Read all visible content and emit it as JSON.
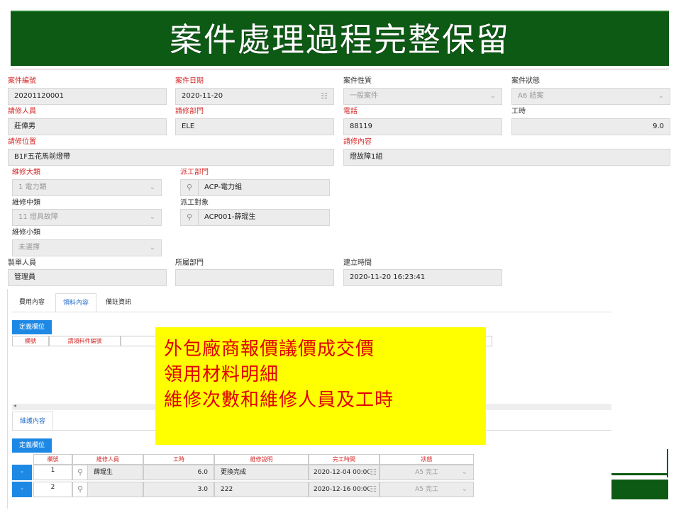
{
  "title": "案件處理過程完整保留",
  "form": {
    "case_no": {
      "label": "案件編號",
      "value": "20201120001"
    },
    "case_date": {
      "label": "案件日期",
      "value": "2020-11-20"
    },
    "case_type": {
      "label": "案件性質",
      "value": "一般案件"
    },
    "case_status": {
      "label": "案件狀態",
      "value": "A6 結案"
    },
    "requester": {
      "label": "請修人員",
      "value": "莊偉男"
    },
    "req_dept": {
      "label": "請修部門",
      "value": "ELE"
    },
    "phone": {
      "label": "電話",
      "value": "88119"
    },
    "work_hours": {
      "label": "工時",
      "value": "9.0"
    },
    "location": {
      "label": "請修位置",
      "value": "B1F五花馬前燈帶"
    },
    "content": {
      "label": "請修內容",
      "value": "燈故障1組"
    },
    "cat_major": {
      "label": "維修大類",
      "value": "1 電力類"
    },
    "dispatch_dept": {
      "label": "派工部門",
      "value": "ACP-電力組"
    },
    "cat_middle": {
      "label": "維修中類",
      "value": "11 燈具故障"
    },
    "dispatch_target": {
      "label": "派工對象",
      "value": "ACP001-薛琨生"
    },
    "cat_minor": {
      "label": "維修小類",
      "value": "未選擇"
    },
    "creator": {
      "label": "製單人員",
      "value": "管理員"
    },
    "owner_dept": {
      "label": "所屬部門",
      "value": ""
    },
    "created_at": {
      "label": "建立時間",
      "value": "2020-11-20 16:23:41"
    }
  },
  "tabs": [
    "費用內容",
    "領料內容",
    "備註資訊"
  ],
  "define_label": "定義欄位",
  "material_headers": [
    "欄號",
    "請領料件編號"
  ],
  "repair_tab": "維護內容",
  "repair_headers": [
    "欄號",
    "維修人員",
    "工時",
    "維修說明",
    "完工時間",
    "狀態"
  ],
  "repair_rows": [
    {
      "no": "1",
      "person": "薛琨生",
      "hours": "6.0",
      "desc": "更換完成",
      "done": "2020-12-04 00:00",
      "status": "A5 完工"
    },
    {
      "no": "2",
      "person": "",
      "hours": "3.0",
      "desc": "222",
      "done": "2020-12-16 00:00",
      "status": "A5 完工"
    }
  ],
  "minus": "-",
  "note": [
    "外包廠商報價議價成交價",
    "領用材料明細",
    "維修次數和維修人員及工時"
  ],
  "colors": {
    "title_bg": "#0d5a14",
    "note_bg": "#ffff00",
    "note_text": "#e00000",
    "required_label": "#d32a2a",
    "accent": "#1e88e5"
  }
}
